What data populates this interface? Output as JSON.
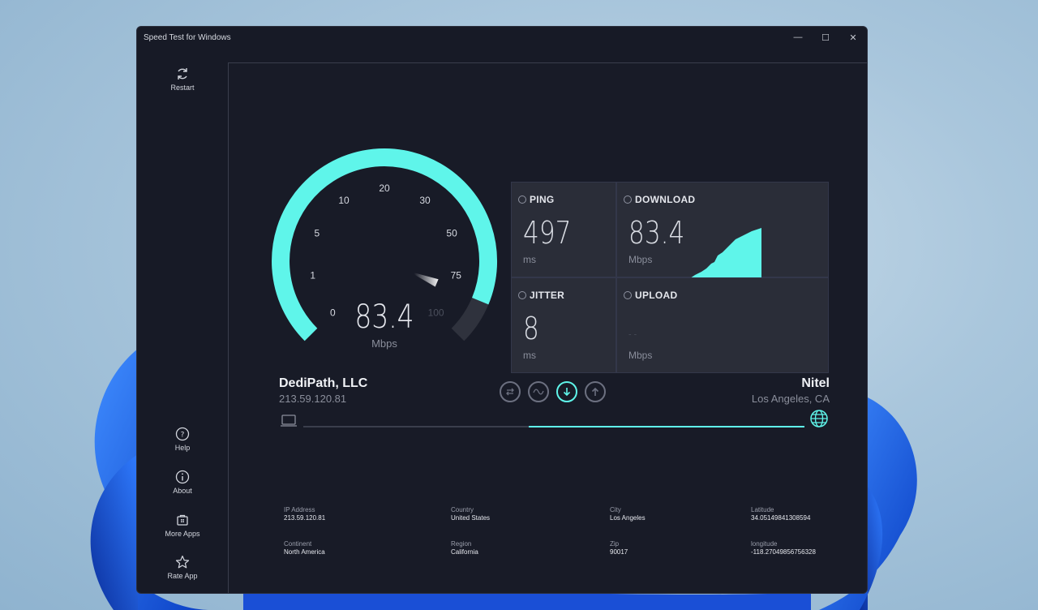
{
  "window": {
    "title": "Speed Test for Windows",
    "minimize": "—",
    "maximize": "☐",
    "close": "✕"
  },
  "sidebar": {
    "restart": "Restart",
    "help": "Help",
    "about": "About",
    "more_apps": "More Apps",
    "rate_app": "Rate App"
  },
  "gauge": {
    "value": "83.4",
    "unit": "Mbps",
    "reading": 83.4,
    "ticks": [
      "0",
      "1",
      "5",
      "10",
      "20",
      "30",
      "50",
      "75",
      "100"
    ]
  },
  "stats": {
    "ping": {
      "label": "PING",
      "value": "497",
      "unit": "ms"
    },
    "download": {
      "label": "DOWNLOAD",
      "value": "83.4",
      "unit": "Mbps"
    },
    "jitter": {
      "label": "JITTER",
      "value": "8",
      "unit": "ms"
    },
    "upload": {
      "label": "UPLOAD",
      "value": "- -",
      "unit": "Mbps"
    }
  },
  "client": {
    "name": "DediPath, LLC",
    "ip": "213.59.120.81"
  },
  "server": {
    "name": "Nitel",
    "location": "Los Angeles, CA"
  },
  "progress": {
    "fraction": 0.55
  },
  "details": {
    "ip_label": "IP Address",
    "ip_value": "213.59.120.81",
    "country_label": "Country",
    "country_value": "United States",
    "city_label": "City",
    "city_value": "Los Angeles",
    "latitude_label": "Latitude",
    "latitude_value": "34.05149841308594",
    "continent_label": "Continent",
    "continent_value": "North America",
    "region_label": "Region",
    "region_value": "California",
    "zip_label": "Zip",
    "zip_value": "90017",
    "longitude_label": "longitude",
    "longitude_value": "-118.27049856756328"
  },
  "colors": {
    "accent": "#5ff5ea",
    "panel": "#2a2d38",
    "background": "#171a26"
  }
}
